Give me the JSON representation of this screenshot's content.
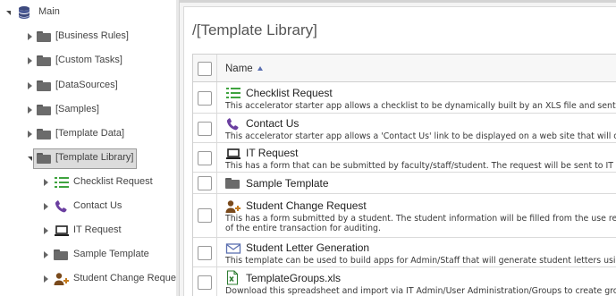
{
  "tree": {
    "root_label": "Main",
    "items": [
      {
        "label": "[Business Rules]"
      },
      {
        "label": "[Custom Tasks]"
      },
      {
        "label": "[DataSources]"
      },
      {
        "label": "[Samples]"
      },
      {
        "label": "[Template Data]"
      },
      {
        "label": "[Template Library]"
      }
    ],
    "children": [
      {
        "label": "Checklist Request",
        "icon": "checklist-icon"
      },
      {
        "label": "Contact Us",
        "icon": "phone-icon"
      },
      {
        "label": "IT Request",
        "icon": "laptop-icon"
      },
      {
        "label": "Sample Template",
        "icon": "folder-icon"
      },
      {
        "label": "Student Change Reques",
        "icon": "user-add-icon"
      }
    ]
  },
  "panel": {
    "title": "/[Template Library]",
    "grid": {
      "column_name": "Name",
      "rows": [
        {
          "title": "Checklist Request",
          "icon": "checklist-icon",
          "desc": [
            "This accelerator starter app allows a checklist to be dynamically built by an XLS file and sent t"
          ]
        },
        {
          "title": "Contact Us",
          "icon": "phone-icon",
          "desc": [
            "This accelerator starter app allows a 'Contact Us' link to be displayed on a web site that will op"
          ]
        },
        {
          "title": "IT Request",
          "icon": "laptop-icon",
          "desc": [
            "This has a form that can be submitted by faculty/staff/student. The request will be sent to IT to"
          ]
        },
        {
          "title": "Sample Template",
          "icon": "folder-icon",
          "desc": []
        },
        {
          "title": "Student Change Request",
          "icon": "user-add-icon",
          "desc": [
            "This has a form submitted by a student. The student information will be filled from the use reco",
            "of the entire transaction for auditing."
          ]
        },
        {
          "title": "Student Letter Generation",
          "icon": "envelope-icon",
          "desc": [
            "This template can be used to build apps for Admin/Staff that will generate student letters using"
          ]
        },
        {
          "title": "TemplateGroups.xls",
          "icon": "excel-file-icon",
          "desc": [
            "Download this spreadsheet and import via IT Admin/User Administration/Groups to create grou"
          ]
        }
      ]
    }
  },
  "colors": {
    "accent": "#5b6fb0",
    "checklist_green": "#3fa33f",
    "phone_purple": "#6b3fa0",
    "excel_green": "#2e7d32",
    "selection_bg": "#dcdcdc"
  }
}
